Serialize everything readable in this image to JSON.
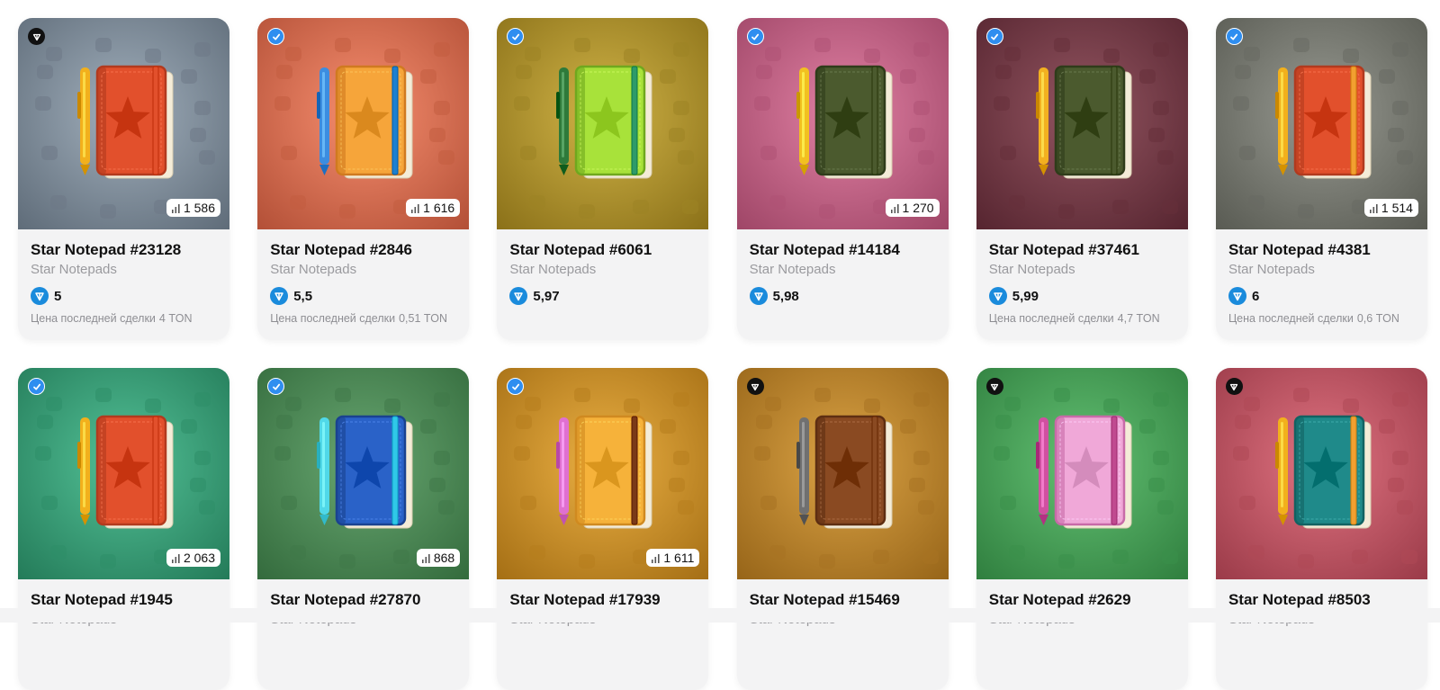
{
  "collection_name": "Star Notepads",
  "last_sale_label": "Цена последней сделки",
  "cards": [
    {
      "title": "Star Notepad #23128",
      "price": "5",
      "last_sale": "4 TON",
      "views": "1 586",
      "badge": "dark",
      "bg": "#8896a3",
      "bg_dark": "#5e6b78",
      "pattern": "#6d7986",
      "book": "#e2502c",
      "spine": "#b23a1e",
      "band": "#e2502c",
      "pen": "#f2b01c"
    },
    {
      "title": "Star Notepad #2846",
      "price": "5,5",
      "last_sale": "0,51 TON",
      "views": "1 616",
      "badge": "verified",
      "bg": "#de7556",
      "bg_dark": "#b24f36",
      "pattern": "#c25c40",
      "book": "#f6a53a",
      "spine": "#d07a20",
      "band": "#1e80d0",
      "pen": "#3c8de0"
    },
    {
      "title": "Star Notepad #6061",
      "price": "5,97",
      "last_sale": "",
      "views": "",
      "badge": "verified",
      "bg": "#b79a2e",
      "bg_dark": "#8a7018",
      "pattern": "#9c8424",
      "book": "#a8e23a",
      "spine": "#6fa81e",
      "band": "#2e9a6a",
      "pen": "#2e7a3a"
    },
    {
      "title": "Star Notepad #14184",
      "price": "5,98",
      "last_sale": "",
      "views": "1 270",
      "badge": "verified",
      "bg": "#c7678a",
      "bg_dark": "#9e4566",
      "pattern": "#ae5274",
      "book": "#4b5a2e",
      "spine": "#2f3c1a",
      "band": "#4b5a2e",
      "pen": "#f2c020"
    },
    {
      "title": "Star Notepad #37461",
      "price": "5,99",
      "last_sale": "4,7 TON",
      "views": "",
      "badge": "verified",
      "bg": "#7a3c48",
      "bg_dark": "#55242f",
      "pattern": "#66303a",
      "book": "#4b5a2e",
      "spine": "#2f3c1a",
      "band": "#4b5a2e",
      "pen": "#f2b020"
    },
    {
      "title": "Star Notepad #4381",
      "price": "6",
      "last_sale": "0,6 TON",
      "views": "1 514",
      "badge": "verified",
      "bg": "#7e8078",
      "bg_dark": "#585a52",
      "pattern": "#686a62",
      "book": "#e2502c",
      "spine": "#b23a1e",
      "band": "#f2a030",
      "pen": "#f2b01c"
    },
    {
      "title": "Star Notepad #1945",
      "price": "",
      "last_sale": "",
      "views": "2 063",
      "badge": "verified",
      "bg": "#3aa87e",
      "bg_dark": "#237a58",
      "pattern": "#2e8e68",
      "book": "#e2502c",
      "spine": "#b23a1e",
      "band": "#e2502c",
      "pen": "#f2b01c"
    },
    {
      "title": "Star Notepad #27870",
      "price": "",
      "last_sale": "",
      "views": "868",
      "badge": "verified",
      "bg": "#4f8e58",
      "bg_dark": "#336a3c",
      "pattern": "#3f7848",
      "book": "#2a62c8",
      "spine": "#1a4290",
      "band": "#30c8e8",
      "pen": "#50d8e8"
    },
    {
      "title": "Star Notepad #17939",
      "price": "",
      "last_sale": "",
      "views": "1 611",
      "badge": "verified",
      "bg": "#d1962a",
      "bg_dark": "#a46e14",
      "pattern": "#b67e1e",
      "book": "#f6b23a",
      "spine": "#d08a20",
      "band": "#7a3a18",
      "pen": "#e070d0"
    },
    {
      "title": "Star Notepad #15469",
      "price": "",
      "last_sale": "",
      "views": "",
      "badge": "dark",
      "bg": "#c28a2c",
      "bg_dark": "#966418",
      "pattern": "#a87222",
      "book": "#8a4a22",
      "spine": "#5e2e12",
      "band": "#8a4a22",
      "pen": "#707070"
    },
    {
      "title": "Star Notepad #2629",
      "price": "",
      "last_sale": "",
      "views": "",
      "badge": "dark",
      "bg": "#4aa85a",
      "bg_dark": "#2f7e3e",
      "pattern": "#3a904a",
      "book": "#f0a8d8",
      "spine": "#c86aa8",
      "band": "#c04a90",
      "pen": "#d050a0"
    },
    {
      "title": "Star Notepad #8503",
      "price": "",
      "last_sale": "",
      "views": "",
      "badge": "dark",
      "bg": "#c75a68",
      "bg_dark": "#9a3a48",
      "pattern": "#ae4856",
      "book": "#1f8a8a",
      "spine": "#126262",
      "band": "#f2a030",
      "pen": "#f2b01c"
    }
  ]
}
